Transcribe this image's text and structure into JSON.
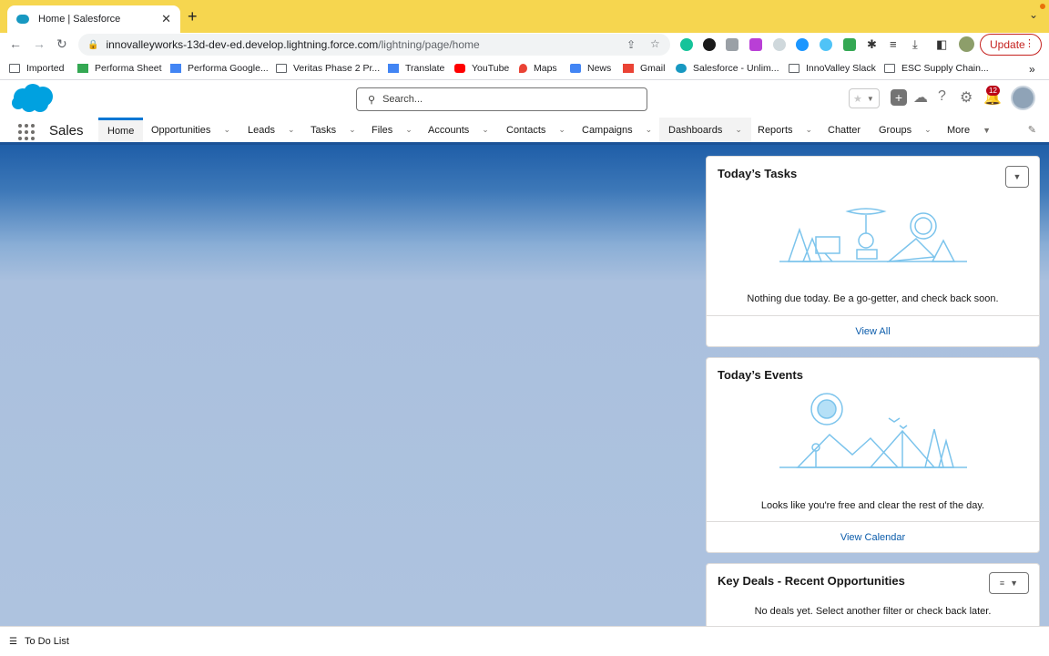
{
  "browser": {
    "tab_title": "Home | Salesforce",
    "url_host": "innovalleyworks-13d-dev-ed.develop.lightning.force.com",
    "url_path": "/lightning/page/home",
    "update_label": "Update",
    "bookmarks": [
      {
        "label": "Imported"
      },
      {
        "label": "Performa Sheet"
      },
      {
        "label": "Performa Google..."
      },
      {
        "label": "Veritas Phase 2 Pr..."
      },
      {
        "label": "Translate"
      },
      {
        "label": "YouTube"
      },
      {
        "label": "Maps"
      },
      {
        "label": "News"
      },
      {
        "label": "Gmail"
      },
      {
        "label": "Salesforce - Unlim..."
      },
      {
        "label": "InnoValley Slack"
      },
      {
        "label": "ESC Supply Chain..."
      }
    ]
  },
  "header": {
    "search_placeholder": "Search...",
    "notification_count": "12"
  },
  "nav": {
    "app_name": "Sales",
    "items": [
      {
        "label": "Home"
      },
      {
        "label": "Opportunities"
      },
      {
        "label": "Leads"
      },
      {
        "label": "Tasks"
      },
      {
        "label": "Files"
      },
      {
        "label": "Accounts"
      },
      {
        "label": "Contacts"
      },
      {
        "label": "Campaigns"
      },
      {
        "label": "Dashboards"
      },
      {
        "label": "Reports"
      },
      {
        "label": "Chatter"
      },
      {
        "label": "Groups"
      },
      {
        "label": "More"
      }
    ]
  },
  "cards": {
    "tasks": {
      "title": "Today’s Tasks",
      "message": "Nothing due today. Be a go-getter, and check back soon.",
      "link": "View All"
    },
    "events": {
      "title": "Today’s Events",
      "message": "Looks like you're free and clear the rest of the day.",
      "link": "View Calendar"
    },
    "deals": {
      "title": "Key Deals - Recent Opportunities",
      "message": "No deals yet. Select another filter or check back later."
    }
  },
  "footer": {
    "todo_label": "To Do List"
  },
  "colors": {
    "chrome_tab_strip": "#f6d64f",
    "salesforce_brand": "#0176d3",
    "link": "#0b5cab",
    "illustration": "#7cc4ec"
  }
}
